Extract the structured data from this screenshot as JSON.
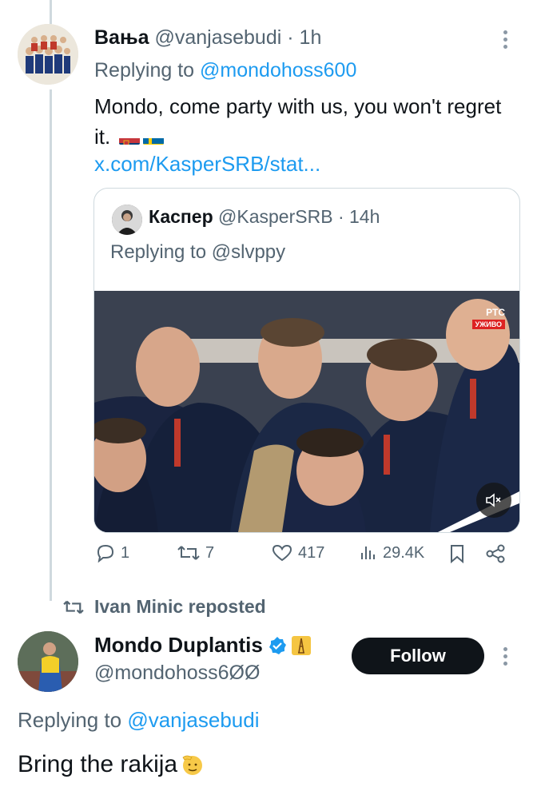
{
  "tweet1": {
    "display_name": "Вања",
    "handle": "@vanjasebudi",
    "time": "· 1h",
    "replying_prefix": "Replying to",
    "replying_to": "@mondohoss600",
    "text": "Mondo, come party with us, you won't regret it.",
    "link": "x.com/KasperSRB/stat..."
  },
  "quoted": {
    "display_name": "Каспер",
    "handle": "@KasperSRB",
    "time": "· 14h",
    "replying_prefix": "Replying to",
    "replying_to": "@slvppy",
    "video_overlay": {
      "channel": "РТС",
      "live": "УЖИВО"
    }
  },
  "actions": {
    "replies": "1",
    "reposts": "7",
    "likes": "417",
    "views": "29.4K"
  },
  "repost_banner": "Ivan Minic reposted",
  "tweet2": {
    "display_name": "Mondo Duplantis",
    "handle": "@mondohoss6ØØ",
    "follow_label": "Follow",
    "replying_prefix": "Replying to",
    "replying_to": "@vanjasebudi",
    "text": "Bring the rakija"
  },
  "colors": {
    "link": "#1d9bf0",
    "secondary_text": "#536471",
    "verified": "#1d9bf0"
  }
}
